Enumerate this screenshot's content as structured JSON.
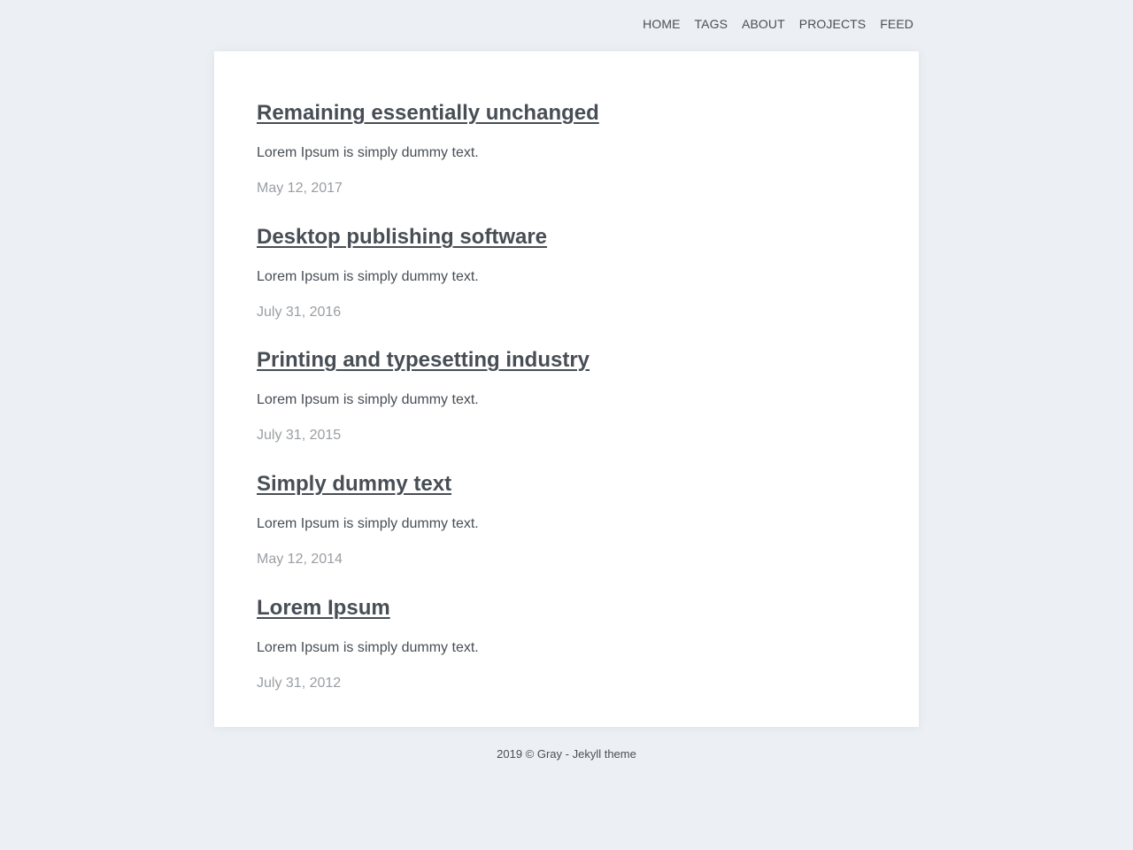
{
  "nav": {
    "items": [
      "HOME",
      "TAGS",
      "ABOUT",
      "PROJECTS",
      "FEED"
    ]
  },
  "posts": [
    {
      "title": "Remaining essentially unchanged",
      "excerpt": "Lorem Ipsum is simply dummy text.",
      "date": "May 12, 2017"
    },
    {
      "title": "Desktop publishing software",
      "excerpt": "Lorem Ipsum is simply dummy text.",
      "date": "July 31, 2016"
    },
    {
      "title": "Printing and typesetting industry",
      "excerpt": "Lorem Ipsum is simply dummy text.",
      "date": "July 31, 2015"
    },
    {
      "title": "Simply dummy text",
      "excerpt": "Lorem Ipsum is simply dummy text.",
      "date": "May 12, 2014"
    },
    {
      "title": "Lorem Ipsum",
      "excerpt": "Lorem Ipsum is simply dummy text.",
      "date": "July 31, 2012"
    }
  ],
  "footer": {
    "text": "2019 © Gray - Jekyll theme"
  }
}
